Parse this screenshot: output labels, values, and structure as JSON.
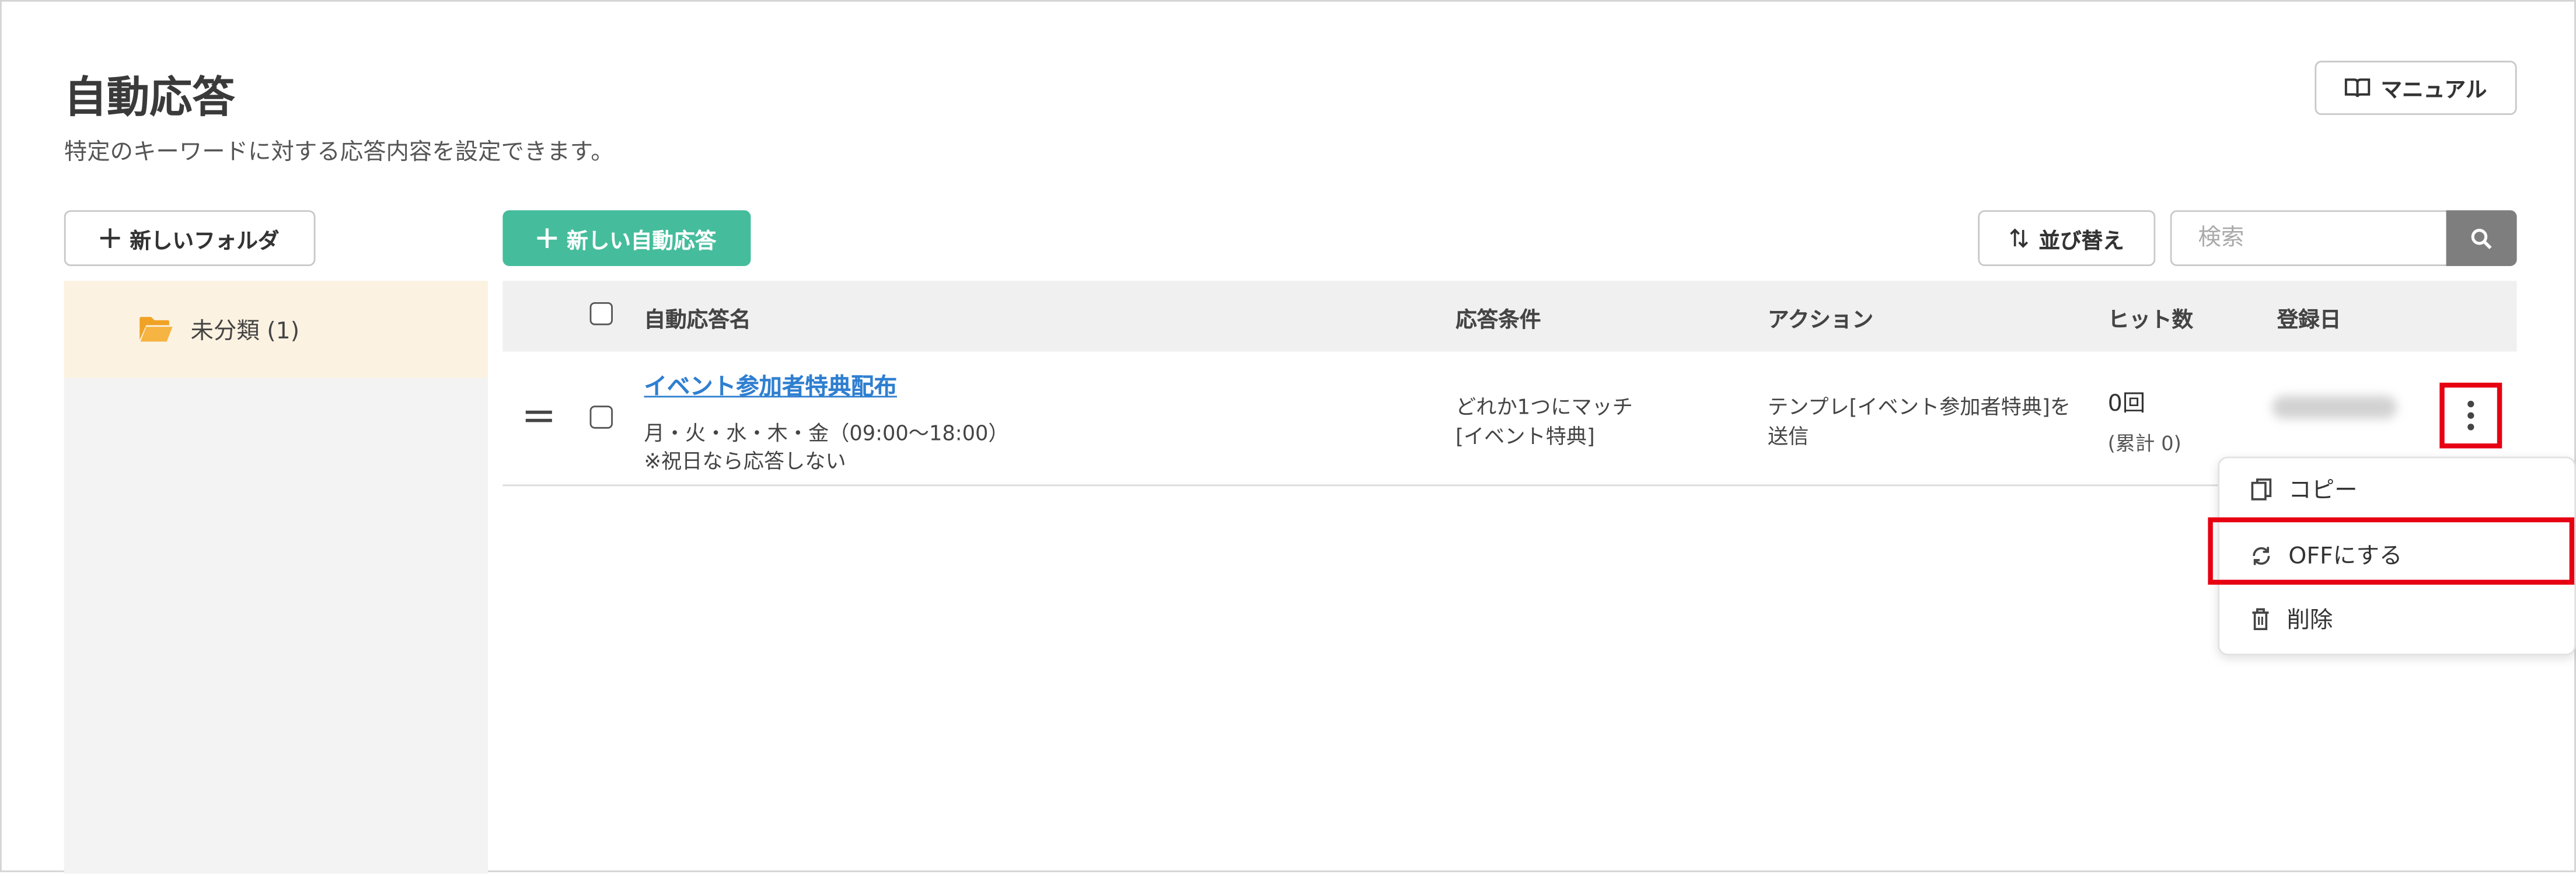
{
  "header": {
    "title": "自動応答",
    "subtitle": "特定のキーワードに対する応答内容を設定できます。",
    "manual_label": "マニュアル"
  },
  "toolbar": {
    "new_folder_label": "新しいフォルダ",
    "new_auto_response_label": "新しい自動応答",
    "sort_label": "並び替え",
    "search_placeholder": "検索"
  },
  "sidebar": {
    "folders": [
      {
        "label": "未分類 (1)"
      }
    ]
  },
  "table": {
    "columns": [
      "自動応答名",
      "応答条件",
      "アクション",
      "ヒット数",
      "登録日"
    ],
    "rows": [
      {
        "name": "イベント参加者特典配布",
        "schedule": "月・火・水・木・金（09:00〜18:00）",
        "holiday_note": "※祝日なら応答しない",
        "condition_line1": "どれか1つにマッチ",
        "condition_line2": "[イベント特典]",
        "action_line1": "テンプレ[イベント参加者特典]を",
        "action_line2": "送信",
        "hits": "0回",
        "hits_total": "(累計 0)"
      }
    ]
  },
  "context_menu": {
    "items": [
      {
        "label": "コピー",
        "icon": "copy-icon"
      },
      {
        "label": "OFFにする",
        "icon": "sync-icon"
      },
      {
        "label": "削除",
        "icon": "trash-icon"
      }
    ]
  },
  "colors": {
    "accent_green": "#45bd9c",
    "link_blue": "#2f7fd0",
    "highlight_red": "#e60012",
    "folder_orange": "#f0a225",
    "selected_folder_bg": "#fcf2e1"
  }
}
